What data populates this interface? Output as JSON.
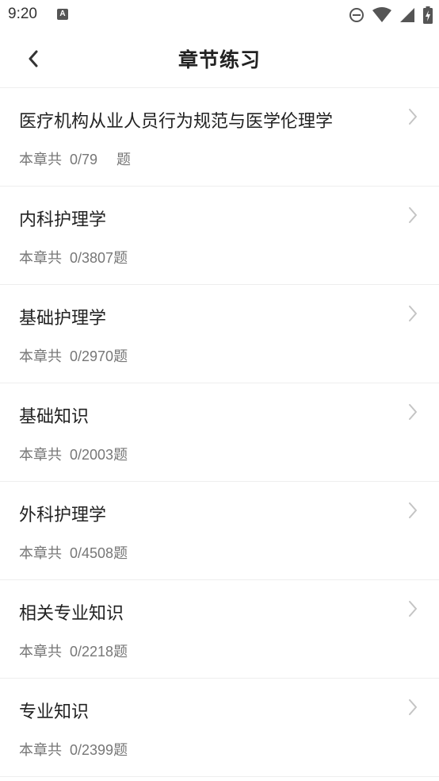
{
  "status_bar": {
    "time": "9:20",
    "app_icon_letter": "A",
    "icons": [
      "do-not-disturb-icon",
      "wifi-icon",
      "signal-icon",
      "battery-charging-icon"
    ]
  },
  "header": {
    "title": "章节练习",
    "back_icon": "chevron-left-icon"
  },
  "chapters": [
    {
      "title": "医疗机构从业人员行为规范与医学伦理学",
      "prefix": "本章共",
      "progress": "0/79",
      "suffix": "题"
    },
    {
      "title": "内科护理学",
      "prefix": "本章共",
      "progress": "0/3807",
      "suffix": "题"
    },
    {
      "title": "基础护理学",
      "prefix": "本章共",
      "progress": "0/2970",
      "suffix": "题"
    },
    {
      "title": "基础知识",
      "prefix": "本章共",
      "progress": "0/2003",
      "suffix": "题"
    },
    {
      "title": "外科护理学",
      "prefix": "本章共",
      "progress": "0/4508",
      "suffix": "题"
    },
    {
      "title": "相关专业知识",
      "prefix": "本章共",
      "progress": "0/2218",
      "suffix": "题"
    },
    {
      "title": "专业知识",
      "prefix": "本章共",
      "progress": "0/2399",
      "suffix": "题"
    }
  ],
  "colors": {
    "title_text": "#222222",
    "meta_text": "#777777",
    "divider": "#eeeeee",
    "chevron": "#c4c4c4"
  }
}
